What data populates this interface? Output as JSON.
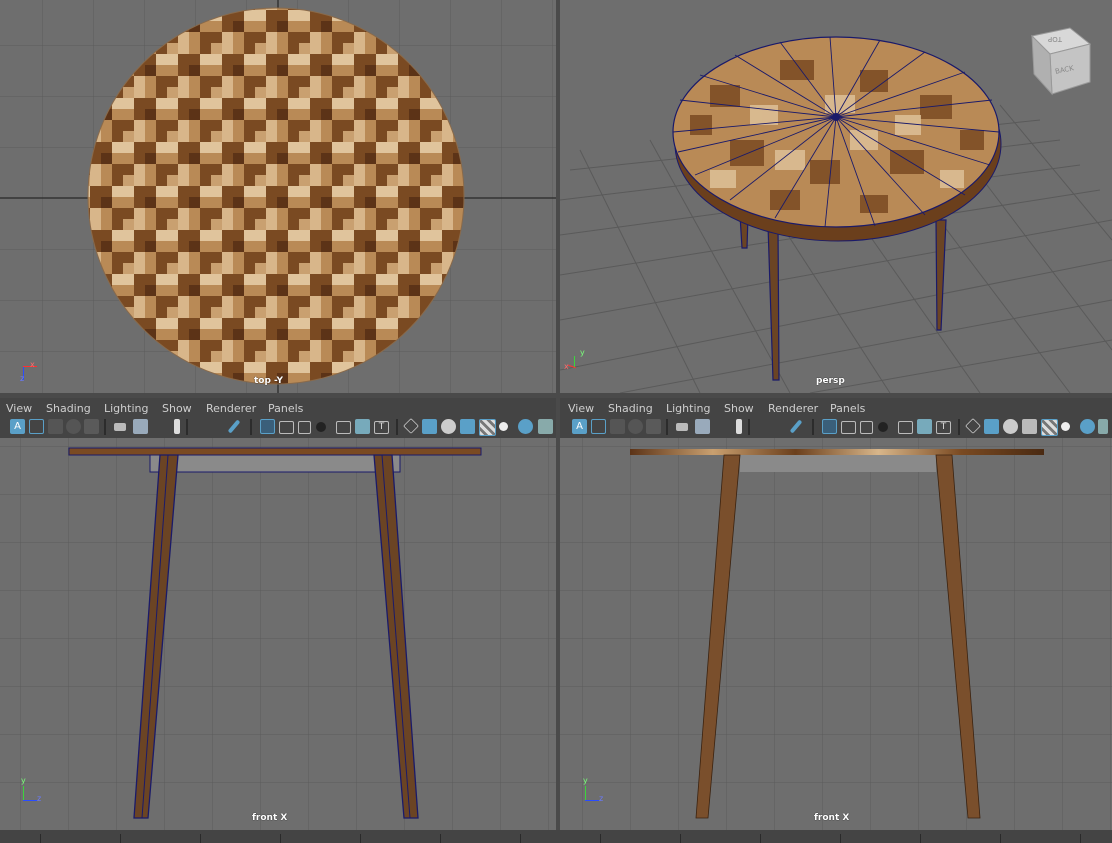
{
  "viewports": {
    "top_left": {
      "label": "top -Y"
    },
    "top_right": {
      "label": "persp"
    },
    "bottom_left": {
      "label": "front X"
    },
    "bottom_right": {
      "label": "front X"
    }
  },
  "view_cube": {
    "top_face": "TOP",
    "side_face": "BACK"
  },
  "axis_labels": {
    "top_x": "x",
    "top_z": "z",
    "persp_y": "y",
    "persp_x": "x",
    "front_y": "y",
    "front_z": "z"
  },
  "panel_menu": [
    "View",
    "Shading",
    "Lighting",
    "Show",
    "Renderer",
    "Panels"
  ],
  "toolbar_icons": [
    "select-camera-icon",
    "grid-toggle-icon",
    "camera-icon",
    "bookmark-icon",
    "pencil-icon",
    "grid-icon",
    "film-gate-icon",
    "resolution-gate-icon",
    "safe-icon",
    "wireframe-icon",
    "smooth-shade-icon",
    "texture-icon",
    "xray-icon",
    "light-icon"
  ],
  "colors": {
    "viewport_bg": "#6e6e6e",
    "ui_bg": "#444444",
    "highlight": "#5aa0c8",
    "wood_dark": "#6b3f1c",
    "wood_light": "#d9b88a"
  }
}
